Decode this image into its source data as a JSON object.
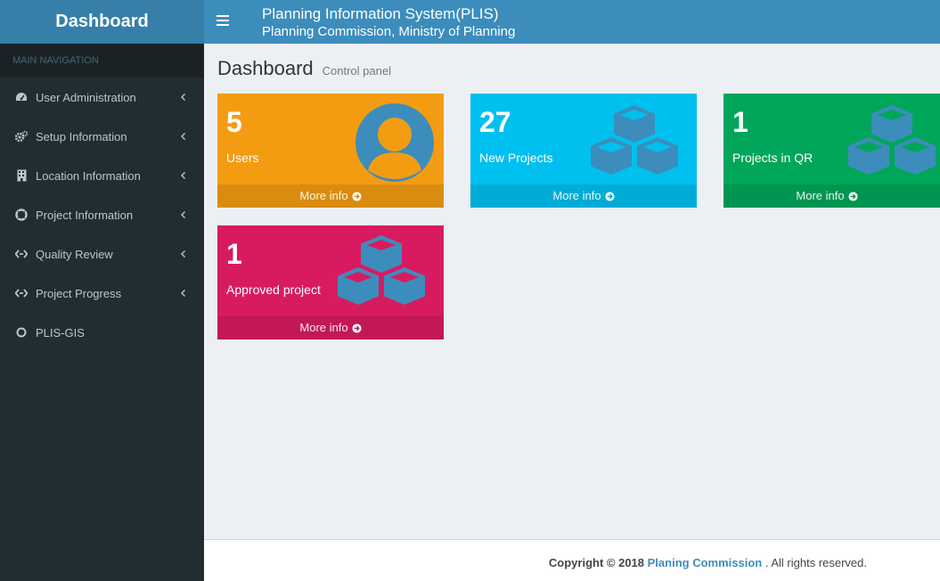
{
  "sidebar": {
    "logo": "Dashboard",
    "nav_header": "MAIN NAVIGATION",
    "items": [
      {
        "label": "User Administration",
        "icon": "dashboard-gauge-icon"
      },
      {
        "label": "Setup Information",
        "icon": "cogs-icon"
      },
      {
        "label": "Location Information",
        "icon": "building-icon"
      },
      {
        "label": "Project Information",
        "icon": "life-ring-icon"
      },
      {
        "label": "Quality Review",
        "icon": "code-fork-icon"
      },
      {
        "label": "Project Progress",
        "icon": "code-fork-icon"
      },
      {
        "label": "PLIS-GIS",
        "icon": "circle-outline-icon"
      }
    ]
  },
  "header": {
    "title": "Planning Information System(PLIS)",
    "subtitle": "Planning Commission, Ministry of Planning"
  },
  "content": {
    "title": "Dashboard",
    "subtitle": "Control panel"
  },
  "boxes": [
    {
      "number": "5",
      "label": "Users",
      "more": "More info",
      "icon": "user-circle-icon"
    },
    {
      "number": "27",
      "label": "New Projects",
      "more": "More info",
      "icon": "cubes-icon"
    },
    {
      "number": "1",
      "label": "Projects in QR",
      "more": "More info",
      "icon": "cubes-icon"
    },
    {
      "number": "1",
      "label": "Approved project",
      "more": "More info",
      "icon": "cubes-icon"
    }
  ],
  "footer": {
    "copyright": "Copyright © 2018",
    "link": "Planing Commission",
    "rest": ". All rights reserved."
  },
  "colors": {
    "sidebar": "#222d32",
    "header": "#3c8dbc",
    "yellow": "#f39c12",
    "aqua": "#00c0ef",
    "green": "#00a65a",
    "maroon": "#d81b60",
    "icon_blue": "#3c8dbc"
  }
}
